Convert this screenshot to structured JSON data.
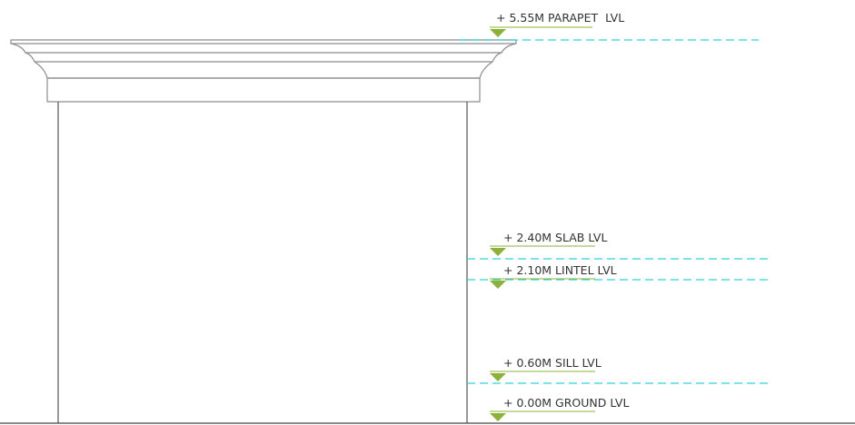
{
  "drawing": {
    "colors": {
      "outline": "#8c8c8c",
      "wall": "#555555",
      "level_line": "#2ed3dc",
      "marker": "#8cb03a",
      "underline": "#8cb03a",
      "ground": "#444444",
      "text": "#333333"
    },
    "levels": [
      {
        "id": "parapet",
        "label": "+ 5.55M PARAPET  LVL"
      },
      {
        "id": "slab",
        "label": "+ 2.40M SLAB LVL"
      },
      {
        "id": "lintel",
        "label": "+ 2.10M LINTEL LVL"
      },
      {
        "id": "sill",
        "label": "+ 0.60M SILL LVL"
      },
      {
        "id": "ground",
        "label": "+ 0.00M GROUND LVL"
      }
    ]
  }
}
